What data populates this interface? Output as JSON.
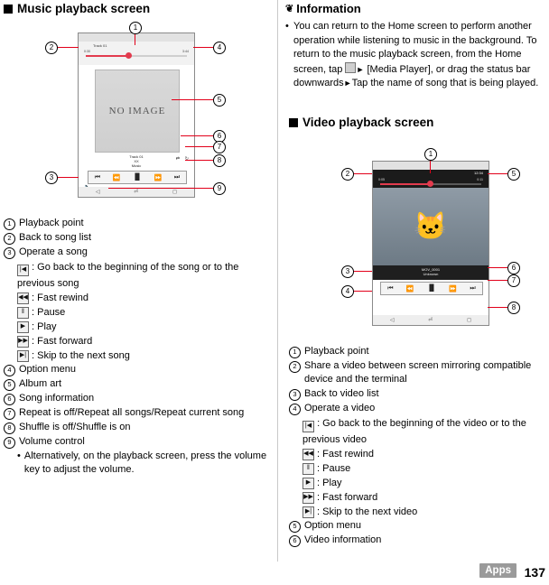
{
  "left": {
    "heading": "Music playback screen",
    "phone": {
      "song_title": "Track 01",
      "time_left": "0:30",
      "time_right": "3:44",
      "album_art_label": "NO IMAGE",
      "info_line1": "Track 01",
      "info_line2": "XX",
      "info_line3": "Music",
      "controls": [
        "shuffle",
        "previous",
        "rewind",
        "pause",
        "fast-forward",
        "next"
      ],
      "volume_label": "volume"
    },
    "callouts": [
      "1",
      "2",
      "3",
      "4",
      "5",
      "6",
      "7",
      "8",
      "9"
    ],
    "legend": [
      {
        "n": "a",
        "text": "Playback point"
      },
      {
        "n": "b",
        "text": "Back to song list"
      },
      {
        "n": "c",
        "text": "Operate a song"
      },
      {
        "n": "d",
        "text": "Option menu"
      },
      {
        "n": "e",
        "text": "Album art"
      },
      {
        "n": "f",
        "text": "Song information"
      },
      {
        "n": "g",
        "text": "Repeat is off/Repeat all songs/Repeat current song"
      },
      {
        "n": "h",
        "text": "Shuffle is off/Shuffle is on"
      },
      {
        "n": "i",
        "text": "Volume control"
      }
    ],
    "song_ops": [
      {
        "glyph": "|◀",
        "text": ": Go back to the beginning of the song or to the previous song"
      },
      {
        "glyph": "◀◀",
        "text": ": Fast rewind"
      },
      {
        "glyph": "‖",
        "text": ": Pause"
      },
      {
        "glyph": "▶",
        "text": ": Play"
      },
      {
        "glyph": "▶▶",
        "text": ": Fast forward"
      },
      {
        "glyph": "▶|",
        "text": ": Skip to the next song"
      }
    ],
    "volume_note": "Alternatively, on the playback screen, press the volume key to adjust the volume."
  },
  "right": {
    "info_heading": "Information",
    "info_bullet": "You can return to the Home screen to perform another operation while listening to music in the background. To return to the music playback screen, from the Home screen, tap",
    "info_bullet_2": "[Media Player], or drag the status bar downwards",
    "info_bullet_3": "Tap the name of song that is being played.",
    "video_heading": "Video playback screen",
    "phone": {
      "time_left": "0:05",
      "time_right": "0:11",
      "clock": "12:34",
      "info_line1": "MOV_0001",
      "info_line2": "Unknown"
    },
    "callouts": [
      "1",
      "2",
      "3",
      "4",
      "5",
      "6",
      "7",
      "8"
    ],
    "legend": [
      {
        "n": "a",
        "text": "Playback point"
      },
      {
        "n": "b",
        "text": "Share a video between screen mirroring compatible device and the terminal"
      },
      {
        "n": "c",
        "text": "Back to video list"
      },
      {
        "n": "d",
        "text": "Operate a video"
      },
      {
        "n": "e",
        "text": "Option menu"
      },
      {
        "n": "f",
        "text": "Video information"
      }
    ],
    "video_ops": [
      {
        "glyph": "|◀",
        "text": ": Go back to the beginning of the video or to the previous video"
      },
      {
        "glyph": "◀◀",
        "text": ": Fast rewind"
      },
      {
        "glyph": "‖",
        "text": ": Pause"
      },
      {
        "glyph": "▶",
        "text": ": Play"
      },
      {
        "glyph": "▶▶",
        "text": ": Fast forward"
      },
      {
        "glyph": "▶|",
        "text": ": Skip to the next video"
      }
    ]
  },
  "footer": {
    "section": "Apps",
    "page": "137"
  },
  "colors": {
    "lead_line": "#e2001a",
    "accent": "#e23b4e",
    "divider": "#c9c9c9"
  }
}
